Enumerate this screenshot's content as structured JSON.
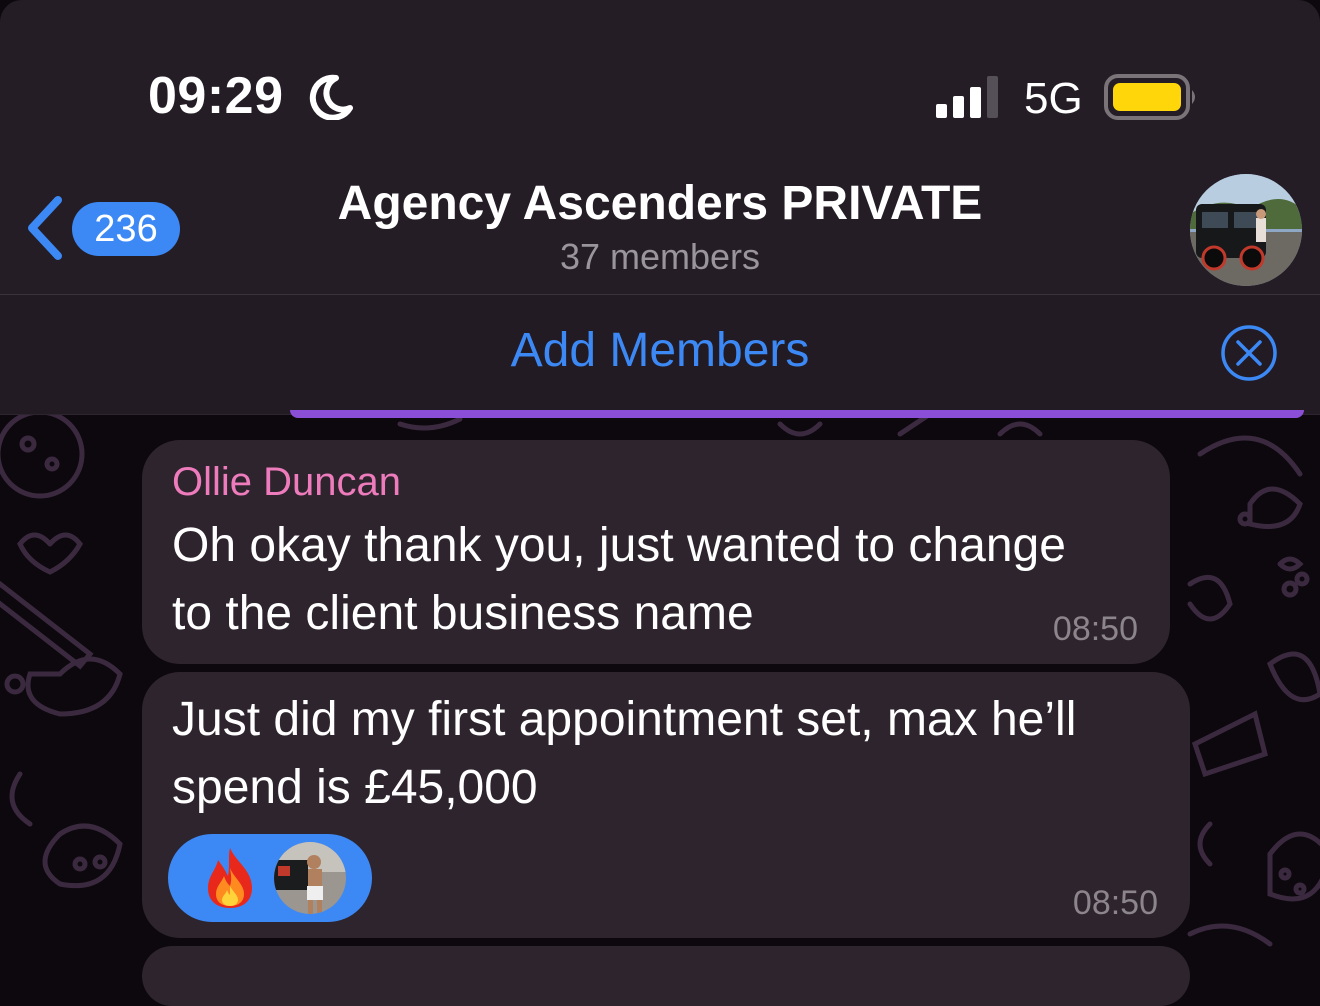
{
  "status_bar": {
    "time": "09:29",
    "network": "5G",
    "moon_icon": "moon-icon",
    "signal_icon": "cellular-signal-icon",
    "battery_icon": "battery-icon",
    "battery_color": "#ffd60a"
  },
  "header": {
    "unread_count": "236",
    "title": "Agency Ascenders PRIVATE",
    "subtitle": "37 members",
    "accent_color": "#3c89f5"
  },
  "add_bar": {
    "label": "Add Members"
  },
  "messages": [
    {
      "sender": "Ollie Duncan",
      "lines": [
        "Oh okay thank you, just wanted to change",
        "to the client business name"
      ],
      "time": "08:50"
    },
    {
      "lines": [
        "Just did my first appointment set, max he’ll",
        "spend is £45,000"
      ],
      "time": "08:50",
      "reaction": {
        "emoji_icon": "fire-icon",
        "reactor_icon": "user-avatar"
      }
    }
  ]
}
